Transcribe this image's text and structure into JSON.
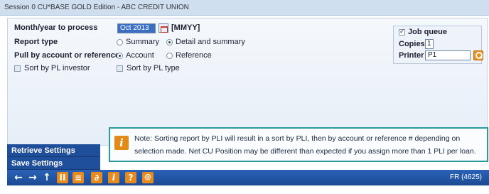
{
  "window": {
    "title": "Session 0 CU*BASE GOLD Edition - ABC CREDIT UNION"
  },
  "form": {
    "month_label": "Month/year to process",
    "month_value": "Oct 2013",
    "month_format": "[MMYY]",
    "report_type_label": "Report type",
    "report_type_options": [
      "Summary",
      "Detail and summary"
    ],
    "report_type_selected": "Detail and summary",
    "pull_label": "Pull by account or reference",
    "pull_options": [
      "Account",
      "Reference"
    ],
    "pull_selected": "Account",
    "sort_investor_label": "Sort by PL investor",
    "sort_type_label": "Sort by PL type"
  },
  "job": {
    "job_queue_label": "Job queue",
    "job_queue_checked": true,
    "copies_label": "Copies",
    "copies_value": "1",
    "printer_label": "Printer",
    "printer_value": "P1"
  },
  "side_buttons": {
    "retrieve": "Retrieve Settings",
    "save": "Save Settings"
  },
  "note": {
    "icon": "info-icon",
    "line1": "Note: Sorting report by PLI will result in a sort by PLI, then by account or reference # depending on",
    "line2": "selection made. Net CU Position may be different than expected if you assign more than 1 PLI per loan."
  },
  "toolbar": {
    "back": "←",
    "forward": "→",
    "up": "↑",
    "pause": "II",
    "print": "≡",
    "link": "∂",
    "info": "i",
    "help": "?",
    "at": "@",
    "screen_code": "FR (4625)"
  },
  "colors": {
    "accent": "#1f4f9a",
    "icon_orange": "#e48a1f",
    "note_border": "#2c9a9a"
  }
}
